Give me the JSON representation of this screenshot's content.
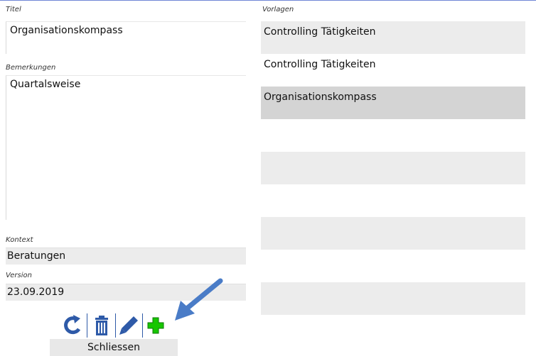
{
  "form": {
    "title_label": "Titel",
    "title_value": "Organisationskompass",
    "remarks_label": "Bemerkungen",
    "remarks_value": "Quartalsweise",
    "context_label": "Kontext",
    "context_value": "Beratungen",
    "version_label": "Version",
    "version_value": "23.09.2019"
  },
  "templates": {
    "label": "Vorlagen",
    "items": [
      {
        "text": "Controlling Tätigkeiten",
        "state": "alt"
      },
      {
        "text": "Controlling Tätigkeiten",
        "state": "normal"
      },
      {
        "text": "Organisationskompass",
        "state": "selected"
      },
      {
        "text": "",
        "state": "normal"
      },
      {
        "text": "",
        "state": "alt"
      },
      {
        "text": "",
        "state": "normal"
      },
      {
        "text": "",
        "state": "alt"
      },
      {
        "text": "",
        "state": "normal"
      },
      {
        "text": "",
        "state": "alt"
      }
    ]
  },
  "toolbar": {
    "icons": [
      "refresh-icon",
      "trash-icon",
      "pencil-icon",
      "plus-icon"
    ],
    "colors": {
      "blue": "#2e5aa8",
      "green": "#17c600"
    }
  },
  "close_button": {
    "label": "Schliessen"
  },
  "annotation": {
    "arrow_color": "#4a7cc7"
  }
}
